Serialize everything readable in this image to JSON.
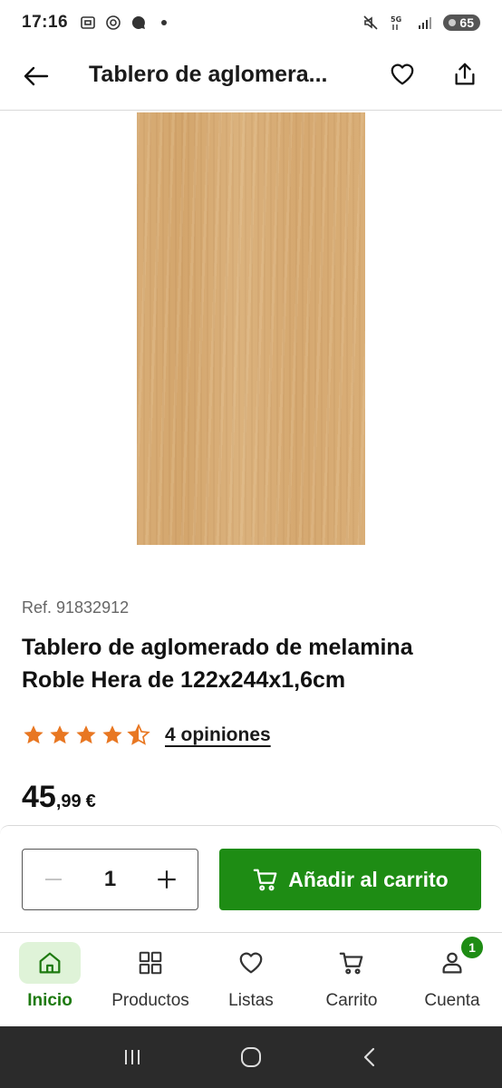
{
  "status_bar": {
    "time": "17:16",
    "battery": "65"
  },
  "header": {
    "title": "Tablero de aglomera..."
  },
  "product": {
    "ref": "Ref. 91832912",
    "name": "Tablero de aglomerado de melamina Roble Hera de 122x244x1,6cm",
    "rating": 4.5,
    "reviews": "4 opiniones",
    "price_int": "45",
    "price_dec": ",99",
    "price_currency": "€"
  },
  "purchase": {
    "quantity": "1",
    "add_to_cart": "Añadir al carrito"
  },
  "bottom_nav": {
    "items": [
      {
        "label": "Inicio",
        "icon": "home-icon",
        "active": true
      },
      {
        "label": "Productos",
        "icon": "grid-icon"
      },
      {
        "label": "Listas",
        "icon": "heart-icon"
      },
      {
        "label": "Carrito",
        "icon": "cart-icon"
      },
      {
        "label": "Cuenta",
        "icon": "user-icon",
        "badge": "1"
      }
    ]
  },
  "colors": {
    "accent": "#1e8c14",
    "star": "#e87722",
    "nav_active_bg": "#dff3d8"
  }
}
